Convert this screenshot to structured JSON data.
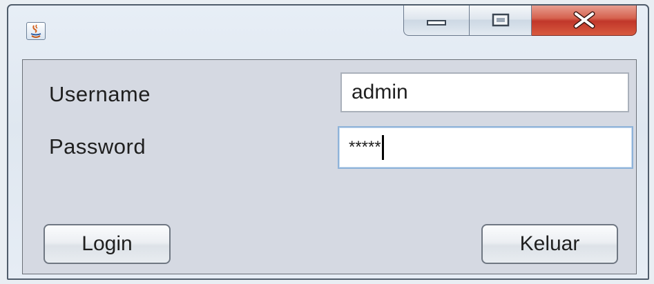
{
  "window": {
    "controls": {
      "minimize_icon": "minimize-icon",
      "maximize_icon": "maximize-icon",
      "close_icon": "close-icon"
    },
    "app_icon": "java-coffee-cup-icon"
  },
  "form": {
    "username_label": "Username",
    "username_value": "admin",
    "password_label": "Password",
    "password_masked": "*****"
  },
  "buttons": {
    "login_label": "Login",
    "keluar_label": "Keluar"
  },
  "colors": {
    "close_button": "#c1372a",
    "client_background": "#d5d9e2",
    "focused_field_border": "#8fb3d9"
  }
}
